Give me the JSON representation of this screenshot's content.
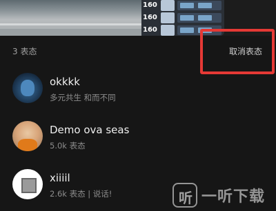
{
  "media": {
    "scores": [
      "160",
      "160",
      "160"
    ]
  },
  "header": {
    "reaction_count": "3 表态",
    "cancel_label": "取消表态"
  },
  "users": [
    {
      "name": "okkkk",
      "sub": "多元共生 和而不同"
    },
    {
      "name": "Demo ova seas",
      "sub": "5.0k 表态"
    },
    {
      "name": "xiiiil",
      "sub": "2.6k 表态 | 说话!"
    }
  ],
  "watermark": {
    "logo_glyph": "听",
    "text": "一听下载"
  },
  "colors": {
    "background": "#161616",
    "highlight": "#e53935"
  }
}
